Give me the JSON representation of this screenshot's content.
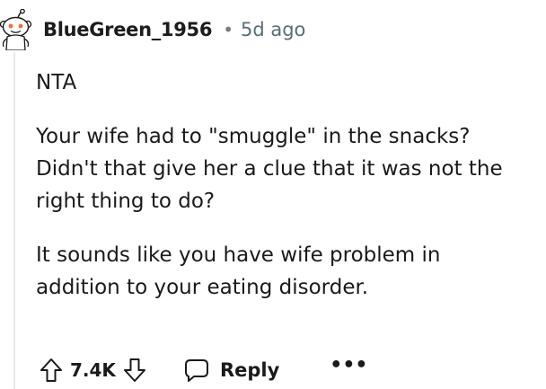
{
  "comment": {
    "author": "BlueGreen_1956",
    "separator": "•",
    "timestamp": "5d ago",
    "paragraphs": [
      "NTA",
      "Your wife had to \"smuggle\" in the snacks?\nDidn't that give her a clue that it was not the\nright thing to do?",
      "It sounds like you have wife problem in\naddition to your eating disorder."
    ]
  },
  "actions": {
    "score": "7.4K",
    "reply_label": "Reply",
    "more_label": "•••",
    "upvote_icon": "arrow-up-icon",
    "downvote_icon": "arrow-down-icon",
    "reply_icon": "speech-bubble-icon"
  },
  "colors": {
    "text": "#1a1a1b",
    "meta": "#576f76",
    "thread_line": "#e6e8ea"
  }
}
